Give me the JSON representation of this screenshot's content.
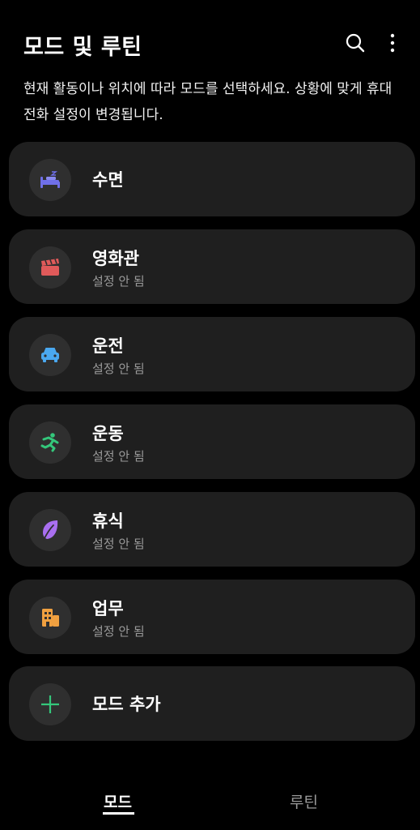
{
  "header": {
    "title": "모드 및 루틴",
    "description": "현재 활동이나 위치에 따라 모드를 선택하세요. 상황에 맞게 휴대전화 설정이 변경됩니다."
  },
  "modes": [
    {
      "title": "수면",
      "subtitle": "",
      "icon": "bed-icon",
      "color": "#6f6fe8"
    },
    {
      "title": "영화관",
      "subtitle": "설정 안 됨",
      "icon": "clapperboard-icon",
      "color": "#e05a5a"
    },
    {
      "title": "운전",
      "subtitle": "설정 안 됨",
      "icon": "car-icon",
      "color": "#4aa8f0"
    },
    {
      "title": "운동",
      "subtitle": "설정 안 됨",
      "icon": "running-icon",
      "color": "#34c77b"
    },
    {
      "title": "휴식",
      "subtitle": "설정 안 됨",
      "icon": "leaf-icon",
      "color": "#a96ff0"
    },
    {
      "title": "업무",
      "subtitle": "설정 안 됨",
      "icon": "building-icon",
      "color": "#f0a040"
    }
  ],
  "add_mode": {
    "label": "모드 추가",
    "icon": "plus-icon",
    "color": "#34c77b"
  },
  "bottom_nav": {
    "tab_modes": "모드",
    "tab_routines": "루틴",
    "active": "모드"
  }
}
